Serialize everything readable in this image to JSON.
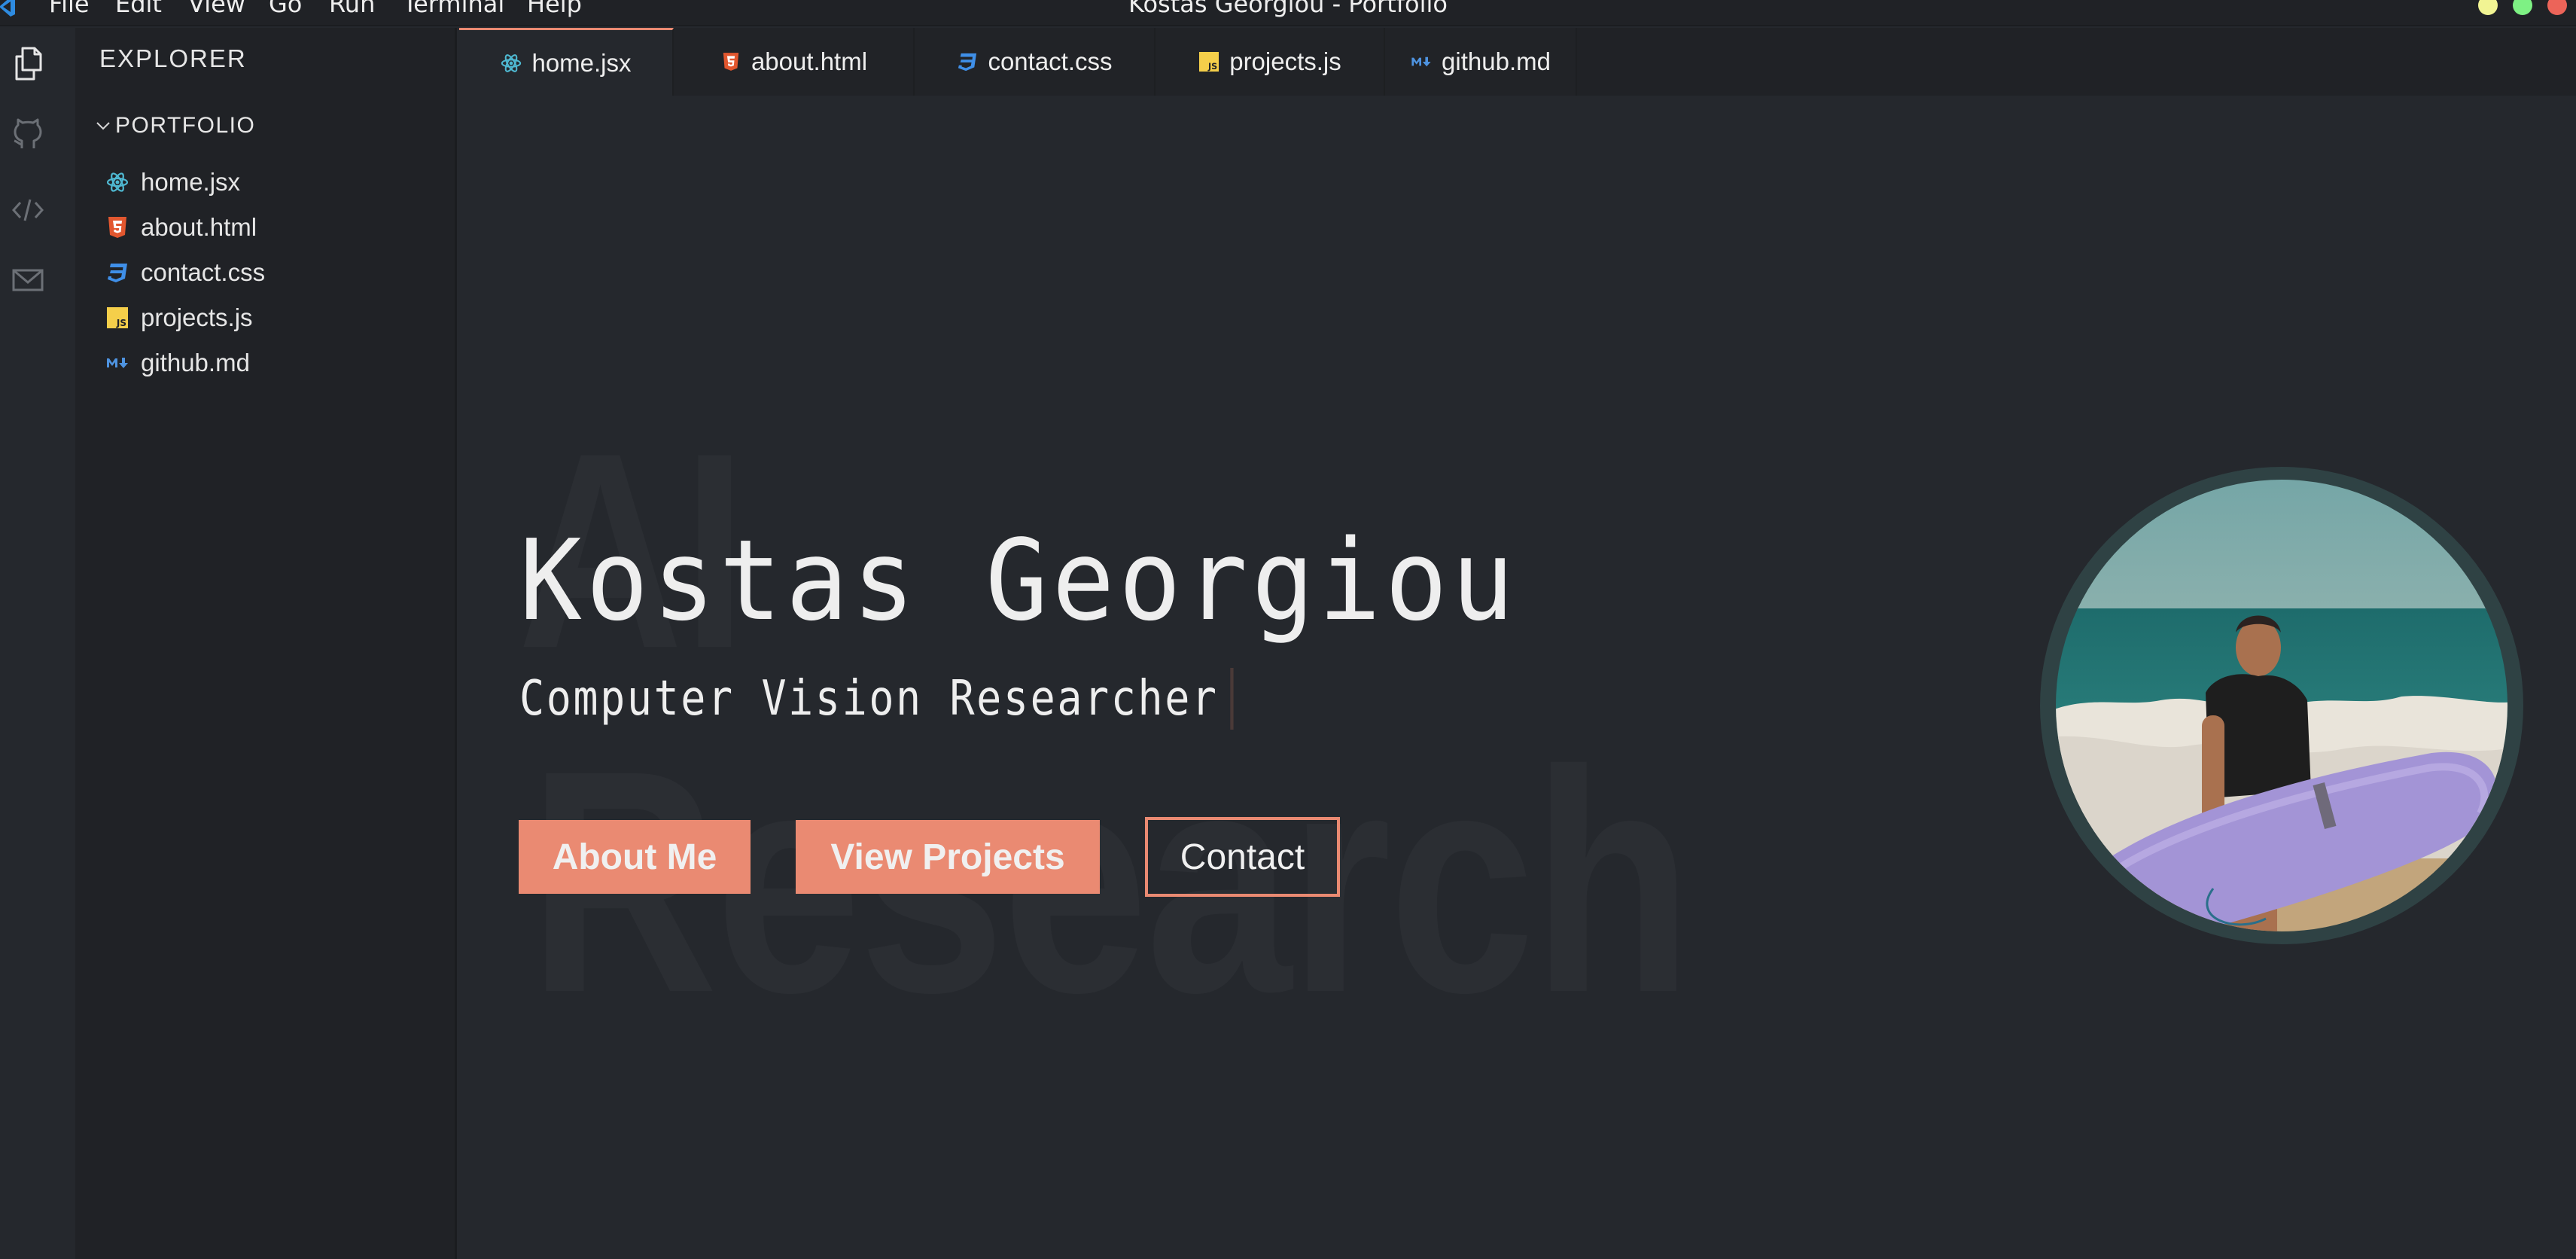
{
  "window": {
    "title": "Kostas Georgiou - Portfolio",
    "menu": [
      "File",
      "Edit",
      "View",
      "Go",
      "Run",
      "Terminal",
      "Help"
    ],
    "controls": {
      "minimize_color": "#f1f493",
      "maximize_color": "#7ef184",
      "close_color": "#ec6459"
    }
  },
  "activity_bar": {
    "items": [
      {
        "name": "explorer",
        "icon": "files-icon",
        "active": true
      },
      {
        "name": "github",
        "icon": "github-icon",
        "active": false
      },
      {
        "name": "code",
        "icon": "code-icon",
        "active": false
      },
      {
        "name": "mail",
        "icon": "mail-icon",
        "active": false
      }
    ]
  },
  "sidebar": {
    "header": "EXPLORER",
    "folder": "PORTFOLIO",
    "files": [
      {
        "name": "home.jsx",
        "icon": "react-icon"
      },
      {
        "name": "about.html",
        "icon": "html5-icon"
      },
      {
        "name": "contact.css",
        "icon": "css3-icon"
      },
      {
        "name": "projects.js",
        "icon": "javascript-icon"
      },
      {
        "name": "github.md",
        "icon": "markdown-icon"
      }
    ]
  },
  "tabs": [
    {
      "label": "home.jsx",
      "icon": "react-icon",
      "active": true
    },
    {
      "label": "about.html",
      "icon": "html5-icon",
      "active": false
    },
    {
      "label": "contact.css",
      "icon": "css3-icon",
      "active": false
    },
    {
      "label": "projects.js",
      "icon": "javascript-icon",
      "active": false
    },
    {
      "label": "github.md",
      "icon": "markdown-icon",
      "active": false
    }
  ],
  "hero": {
    "watermark_line1": "AI",
    "watermark_line2": "Research",
    "name": "Kostas Georgiou",
    "role": "Computer Vision Researcher",
    "buttons": {
      "about": "About Me",
      "projects": "View Projects",
      "contact": "Contact"
    },
    "avatar_alt": "Photo of Kostas Georgiou holding a purple surfboard at the beach"
  },
  "colors": {
    "accent": "#ea8a72",
    "editor_bg": "#25282d",
    "sidebar_bg": "#202226",
    "avatar_ring": "#2f4244",
    "react": "#4fb9d2",
    "html": "#e2572f",
    "css": "#3f8fe8",
    "js": "#f5cf4a",
    "md": "#4e93e0"
  }
}
